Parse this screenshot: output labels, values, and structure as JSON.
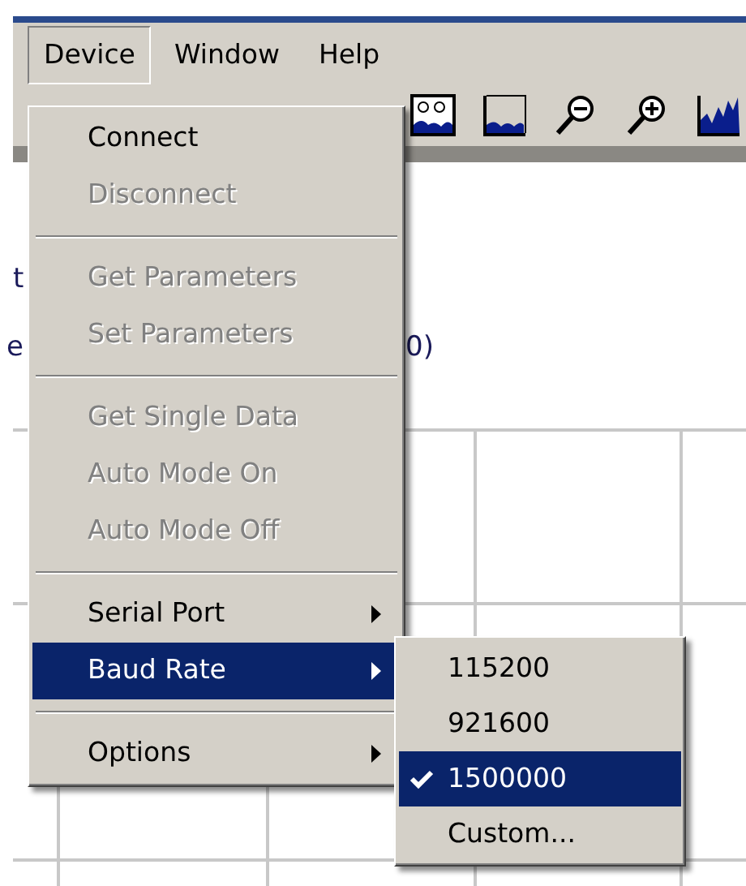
{
  "menubar": [
    {
      "label": "Device",
      "selected": true
    },
    {
      "label": "Window",
      "selected": false
    },
    {
      "label": "Help",
      "selected": false
    }
  ],
  "background_texts": [
    "t",
    "e",
    "0)"
  ],
  "device_menu": [
    {
      "kind": "item",
      "label": "Connect",
      "disabled": false,
      "submenu": false,
      "selected": false
    },
    {
      "kind": "item",
      "label": "Disconnect",
      "disabled": true,
      "submenu": false,
      "selected": false
    },
    {
      "kind": "separator"
    },
    {
      "kind": "item",
      "label": "Get Parameters",
      "disabled": true,
      "submenu": false,
      "selected": false
    },
    {
      "kind": "item",
      "label": "Set Parameters",
      "disabled": true,
      "submenu": false,
      "selected": false
    },
    {
      "kind": "separator"
    },
    {
      "kind": "item",
      "label": "Get Single Data",
      "disabled": true,
      "submenu": false,
      "selected": false
    },
    {
      "kind": "item",
      "label": "Auto Mode On",
      "disabled": true,
      "submenu": false,
      "selected": false
    },
    {
      "kind": "item",
      "label": "Auto Mode Off",
      "disabled": true,
      "submenu": false,
      "selected": false
    },
    {
      "kind": "separator"
    },
    {
      "kind": "item",
      "label": "Serial Port",
      "disabled": false,
      "submenu": true,
      "selected": false
    },
    {
      "kind": "item",
      "label": "Baud Rate",
      "disabled": false,
      "submenu": true,
      "selected": true
    },
    {
      "kind": "separator"
    },
    {
      "kind": "item",
      "label": "Options",
      "disabled": false,
      "submenu": true,
      "selected": false
    }
  ],
  "baud_rate_menu": [
    {
      "label": "115200",
      "checked": false,
      "selected": false
    },
    {
      "label": "921600",
      "checked": false,
      "selected": false
    },
    {
      "label": "1500000",
      "checked": true,
      "selected": true
    },
    {
      "label": "Custom...",
      "checked": false,
      "selected": false
    }
  ]
}
